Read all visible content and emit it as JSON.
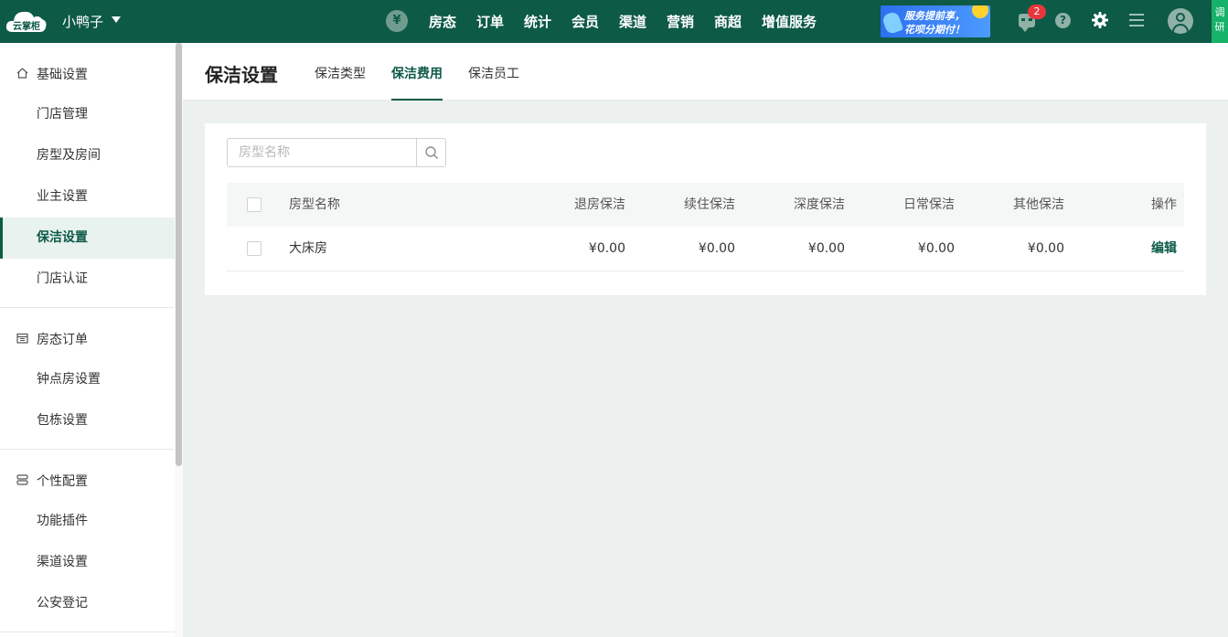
{
  "topbar": {
    "logo_text": "云掌柜",
    "store_name": "小鸭子",
    "currency_symbol": "¥",
    "nav": [
      "房态",
      "订单",
      "统计",
      "会员",
      "渠道",
      "营销",
      "商超",
      "增值服务"
    ],
    "promo_line1": "服务提前享，",
    "promo_line2": "花呗分期付！",
    "message_badge": "2",
    "help_symbol": "?",
    "survey_text": "调研"
  },
  "sidebar": {
    "groups": [
      {
        "label": "基础设置",
        "icon": "home-icon",
        "items": [
          "门店管理",
          "房型及房间",
          "业主设置",
          "保洁设置",
          "门店认证"
        ]
      },
      {
        "label": "房态订单",
        "icon": "calendar-icon",
        "items": [
          "钟点房设置",
          "包栋设置"
        ]
      },
      {
        "label": "个性配置",
        "icon": "stack-icon",
        "items": [
          "功能插件",
          "渠道设置",
          "公安登记"
        ]
      }
    ],
    "active_item": "保洁设置"
  },
  "page": {
    "title": "保洁设置",
    "tabs": [
      "保洁类型",
      "保洁费用",
      "保洁员工"
    ],
    "active_tab": "保洁费用"
  },
  "search": {
    "placeholder": "房型名称"
  },
  "table": {
    "columns": [
      "房型名称",
      "退房保洁",
      "续住保洁",
      "深度保洁",
      "日常保洁",
      "其他保洁",
      "操作"
    ],
    "rows": [
      {
        "room_type": "大床房",
        "checkout": "¥0.00",
        "stay": "¥0.00",
        "deep": "¥0.00",
        "daily": "¥0.00",
        "other": "¥0.00",
        "action": "编辑"
      }
    ]
  },
  "colors": {
    "brand": "#0d5a47",
    "badge": "#e8363c",
    "survey": "#17b26a"
  }
}
